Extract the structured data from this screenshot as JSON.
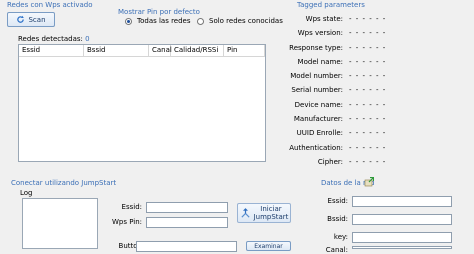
{
  "wps_group": {
    "title": "Redes con Wps activado",
    "scan_label": "Scan"
  },
  "pin_mode": {
    "title": "Mostrar Pin por defecto",
    "options": [
      {
        "label": "Todas las redes",
        "selected": true
      },
      {
        "label": "Solo redes conocidas",
        "selected": false
      }
    ]
  },
  "networks": {
    "label": "Redes detectadas:",
    "count": "0",
    "columns": [
      "Essid",
      "Bssid",
      "Canal",
      "Calidad/RSSi",
      "Pin"
    ]
  },
  "tagged": {
    "title": "Tagged parameters",
    "placeholder": "- - - - - -",
    "items": [
      {
        "label": "Wps state:",
        "value": "- - - - - -"
      },
      {
        "label": "Wps version:",
        "value": "- - - - - -"
      },
      {
        "label": "Response type:",
        "value": "- - - - - -"
      },
      {
        "label": "Model name:",
        "value": "- - - - - -"
      },
      {
        "label": "Model number:",
        "value": "- - - - - -"
      },
      {
        "label": "Serial number:",
        "value": "- - - - - -"
      },
      {
        "label": "Device name:",
        "value": "- - - - - -"
      },
      {
        "label": "Manufacturer:",
        "value": "- - - - - -"
      },
      {
        "label": "UUID Enrolle:",
        "value": "- - - - - -"
      },
      {
        "label": "Authentication:",
        "value": "- - - - - -"
      },
      {
        "label": "Cipher:",
        "value": "- - - - - -"
      }
    ]
  },
  "jumpstart": {
    "title": "Conectar utilizando JumpStart",
    "log_label": "Log",
    "essid_label": "Essid:",
    "wpspin_label": "Wps Pin:",
    "start_label_1": "Iniciar",
    "start_label_2": "JumpStart",
    "button_label": "Button",
    "explore_label": "Examinar"
  },
  "network_data": {
    "title": "Datos de la red",
    "essid_label": "Essid:",
    "bssid_label": "Bssid:",
    "key_label": "key:",
    "extra_label": "Canal:"
  },
  "colors": {
    "accent": "#3b6fb6",
    "background": "#f0f0f0"
  }
}
